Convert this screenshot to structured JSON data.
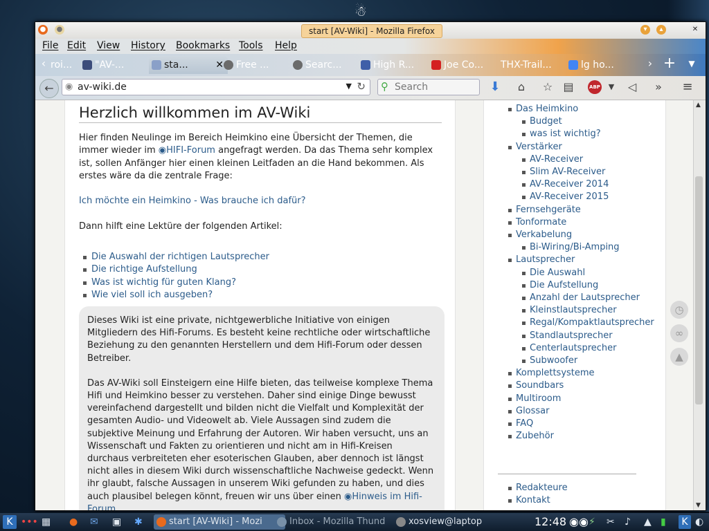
{
  "window": {
    "title": "start [AV-Wiki] - Mozilla Firefox"
  },
  "menu": [
    "File",
    "Edit",
    "View",
    "History",
    "Bookmarks",
    "Tools",
    "Help"
  ],
  "tabs": [
    {
      "label": "roi...",
      "icon": "page-icon"
    },
    {
      "label": "\"AV-...",
      "icon": "hifi-forum-icon"
    },
    {
      "label": "sta...",
      "icon": "speaker-icon",
      "active": true
    },
    {
      "label": "Free ...",
      "icon": "search-engine-icon"
    },
    {
      "label": "Searc...",
      "icon": "search-engine-icon"
    },
    {
      "label": "High R...",
      "icon": "zeta-icon"
    },
    {
      "label": "Joe Co...",
      "icon": "youtube-icon"
    },
    {
      "label": "THX-Trail...",
      "icon": "page-icon"
    },
    {
      "label": "lg ho...",
      "icon": "google-icon"
    }
  ],
  "nav": {
    "url": "av-wiki.de",
    "search_placeholder": "Search",
    "abp_label": "ABP"
  },
  "article": {
    "heading": "Herzlich willkommen im AV-Wiki",
    "intro_1": "Hier finden Neulinge im Bereich Heimkino eine Übersicht der Themen, die immer wieder im ",
    "intro_link": "HIFI-Forum",
    "intro_2": " angefragt werden. Da das Thema sehr komplex ist, sollen Anfänger hier einen kleinen Leitfaden an die Hand bekommen. Als erstes wäre da die zentrale Frage:",
    "question": "Ich möchte ein Heimkino - Was brauche ich dafür?",
    "then": "Dann hilft eine Lektüre der folgenden Artikel:",
    "links": [
      "Die Auswahl der richtigen Lautsprecher",
      "Die richtige Aufstellung",
      "Was ist wichtig für guten Klang?",
      "Wie viel soll ich ausgeben?"
    ],
    "notice_1": "Dieses Wiki ist eine private, nichtgewerbliche Initiative von einigen Mitgliedern des Hifi-Forums. Es besteht keine rechtliche oder wirtschaftliche Beziehung zu den genannten Herstellern und dem Hifi-Forum oder dessen Betreiber.",
    "notice_2": "Das AV-Wiki soll Einsteigern eine Hilfe bieten, das teilweise komplexe Thema Hifi und Heimkino besser zu verstehen. Daher sind einige Dinge bewusst vereinfachend dargestellt und bilden nicht die Vielfalt und Komplexität der gesamten Audio- und Videowelt ab. Viele Aussagen sind zudem die subjektive Meinung und Erfahrung der Autoren. Wir haben versucht, uns an Wissenschaft und Fakten zu orientieren und nicht am in Hifi-Kreisen durchaus verbreiteten eher esoterischen Glauben, aber dennoch ist längst nicht alles in diesem Wiki durch wissenschaftliche Nachweise gedeckt. Wenn ihr glaubt, falsche Aussagen in unserem Wiki gefunden zu haben, und dies auch plausibel belegen könnt, freuen wir uns über einen ",
    "notice_link": "Hinweis im Hifi-Forum",
    "notice_end": "."
  },
  "sidebar": {
    "items": [
      {
        "label": "Das Heimkino",
        "sub": [
          "Budget",
          "was ist wichtig?"
        ]
      },
      {
        "label": "Verstärker",
        "sub": [
          "AV-Receiver",
          "Slim AV-Receiver",
          "AV-Receiver 2014",
          "AV-Receiver 2015"
        ]
      },
      {
        "label": "Fernsehgeräte",
        "sub": []
      },
      {
        "label": "Tonformate",
        "sub": []
      },
      {
        "label": "Verkabelung",
        "sub": [
          "Bi-Wiring/Bi-Amping"
        ]
      },
      {
        "label": "Lautsprecher",
        "sub": [
          "Die Auswahl",
          "Die Aufstellung",
          "Anzahl der Lautsprecher",
          "Kleinstlautsprecher",
          "Regal/Kompaktlautsprecher",
          "Standlautsprecher",
          "Centerlautsprecher",
          "Subwoofer"
        ]
      },
      {
        "label": "Komplettsysteme",
        "sub": []
      },
      {
        "label": "Soundbars",
        "sub": []
      },
      {
        "label": "Multiroom",
        "sub": []
      },
      {
        "label": "Glossar",
        "sub": []
      },
      {
        "label": "FAQ",
        "sub": []
      },
      {
        "label": "Zubehör",
        "sub": []
      }
    ],
    "footer": [
      "Redakteure",
      "Kontakt"
    ]
  },
  "taskbar": {
    "tasks": [
      {
        "label": "start [AV-Wiki] - Mozi",
        "active": true
      },
      {
        "label": "Inbox - Mozilla Thund",
        "active": false
      },
      {
        "label": "xosview@laptop",
        "active": false
      }
    ],
    "clock": "12:48"
  },
  "colors": {
    "link": "#2b5b8a",
    "active_tab": "#b8c6d3",
    "notice_bg": "#ebebeb"
  }
}
